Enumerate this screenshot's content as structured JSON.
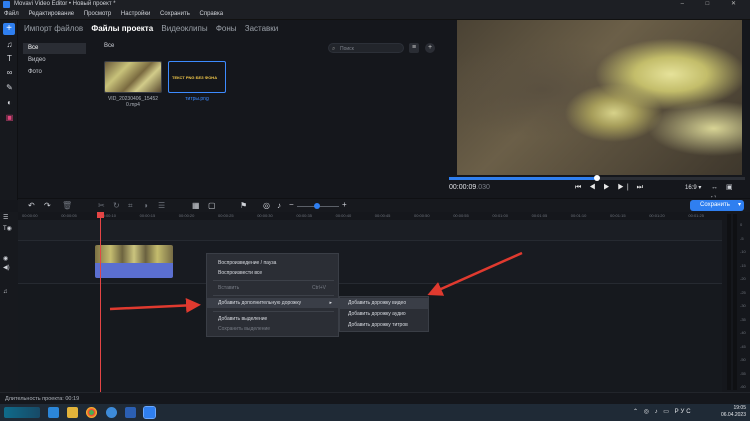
{
  "window": {
    "title": "Movavi Video Editor • Новый проект *",
    "controls": "– □ ✕"
  },
  "menu": [
    "Файл",
    "Редактирование",
    "Просмотр",
    "Настройки",
    "Сохранить",
    "Справка"
  ],
  "tabs": [
    "Импорт файлов",
    "Файлы проекта",
    "Видеоклипы",
    "Фоны",
    "Заставки"
  ],
  "active_tab": 1,
  "categories": [
    "Все",
    "Видео",
    "Фото"
  ],
  "files": {
    "header": "Все",
    "search_placeholder": "Поиск",
    "items": [
      {
        "name": "VID_20230406_15452 0.mp4",
        "type": "video"
      },
      {
        "name": "титры.png",
        "type": "image",
        "caption": "ТЕКСТ PNG БЕЗ ФОНА"
      }
    ]
  },
  "player": {
    "timecode": "00:00:09",
    "timecode_ms": ".030",
    "progress": 0.5,
    "aspect": "16:9 ▾",
    "transport": "⏮ ◀ ▶ ▶| ⏭",
    "controls": "↔ ▣ ⛶"
  },
  "timeline": {
    "save_label": "Сохранить",
    "ruler": [
      "00:00:00",
      "00:00:05",
      "00:00:10",
      "00:00:15",
      "00:00:20",
      "00:00:25",
      "00:00:30",
      "00:00:35",
      "00:00:40",
      "00:00:45",
      "00:00:50",
      "00:00:55",
      "00:01:00",
      "00:01:05",
      "00:01:10",
      "00:01:15",
      "00:01:20",
      "00:01:25"
    ],
    "meter_labels": [
      "0",
      "-5",
      "-10",
      "-15",
      "-20",
      "-25",
      "-30",
      "-35",
      "-40",
      "-45",
      "-50",
      "-55",
      "-60"
    ]
  },
  "context_menu": {
    "items": [
      {
        "label": "Воспроизведение / пауза",
        "enabled": true
      },
      {
        "label": "Воспроизвести все",
        "enabled": true
      },
      {
        "label": "Вставить",
        "enabled": false,
        "shortcut": "Ctrl+V"
      },
      {
        "label": "Добавить дополнительную дорожку",
        "enabled": true,
        "submenu": true
      },
      {
        "label": "Добавить выделение",
        "enabled": true
      },
      {
        "label": "Сохранить выделение",
        "enabled": false
      }
    ],
    "submenu": [
      "Добавить дорожку видео",
      "Добавить дорожку аудио",
      "Добавить дорожку титров"
    ]
  },
  "status": {
    "duration": "Длительность проекта: 00:19"
  },
  "taskbar": {
    "time": "19:05",
    "date": "06.04.2023",
    "lang": "РУС"
  },
  "colors": {
    "accent": "#2f7ff0",
    "playhead": "#e44545",
    "annotation_arrow": "#e03a2f",
    "audio_clip": "#5b6fd0"
  }
}
